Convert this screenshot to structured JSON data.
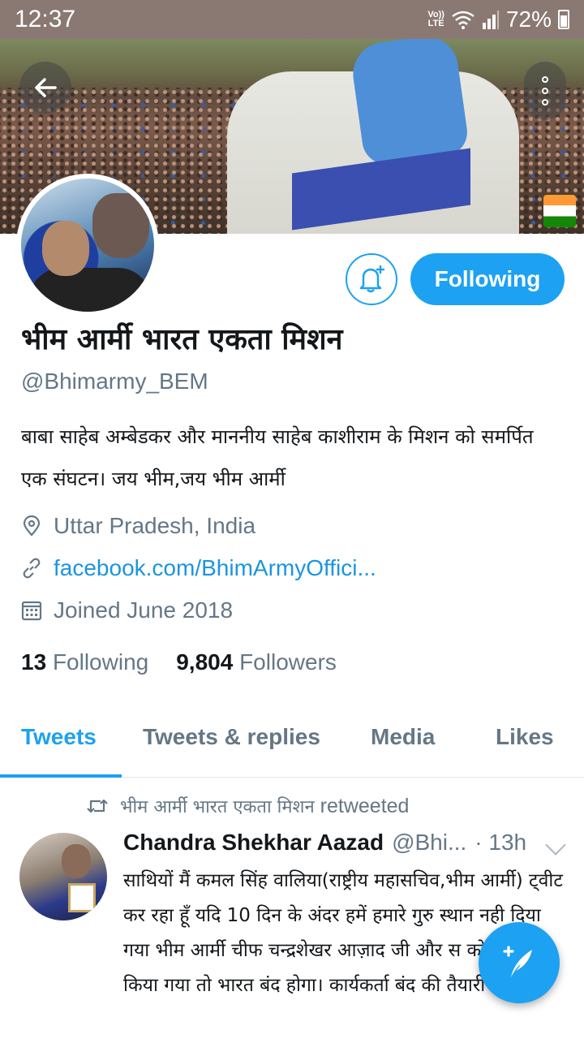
{
  "status_bar": {
    "time": "12:37",
    "network": "Vo)) LTE",
    "battery": "72%"
  },
  "banner": {
    "back_icon": "back-arrow-icon",
    "more_icon": "more-vertical-icon"
  },
  "profile": {
    "display_name": "भीम आर्मी भारत एकता मिशन",
    "handle": "@Bhimarmy_BEM",
    "bio": "बाबा साहेब अम्बेडकर और माननीय साहेब काशीराम के मिशन को समर्पित एक संघटन।  जय भीम,जय भीम आर्मी",
    "location": "Uttar Pradesh, India",
    "website": "facebook.com/BhimArmyOffici...",
    "joined": "Joined June 2018",
    "following_count": "13",
    "following_label": "Following",
    "followers_count": "9,804",
    "followers_label": "Followers",
    "follow_button": "Following"
  },
  "tabs": [
    {
      "label": "Tweets",
      "active": true
    },
    {
      "label": "Tweets & replies",
      "active": false
    },
    {
      "label": "Media",
      "active": false
    },
    {
      "label": "Likes",
      "active": false
    }
  ],
  "tweet": {
    "retweeter": "भीम आर्मी भारत एकता मिशन",
    "retweeted_label": "retweeted",
    "author_name": "Chandra Shekhar Aazad",
    "author_handle": "@Bhi...",
    "time": "· 13h",
    "text": "साथियों मैं कमल सिंह वालिया(राष्ट्रीय महासचिव,भीम आर्मी) ट्वीट कर रहा हूँ यदि 10 दिन के अंदर हमें हमारे गुरु स्थान नही दिया गया   भीम आर्मी चीफ चन्द्रशेखर आज़ाद जी और स   को रिहा नही किया गया तो भारत बंद होगा।   कार्यकर्ता बंद की तैयारी करें।"
  },
  "colors": {
    "accent": "#1da1f2",
    "link": "#1b95e0",
    "secondary_text": "#657786",
    "status_bar": "#8a7872"
  }
}
